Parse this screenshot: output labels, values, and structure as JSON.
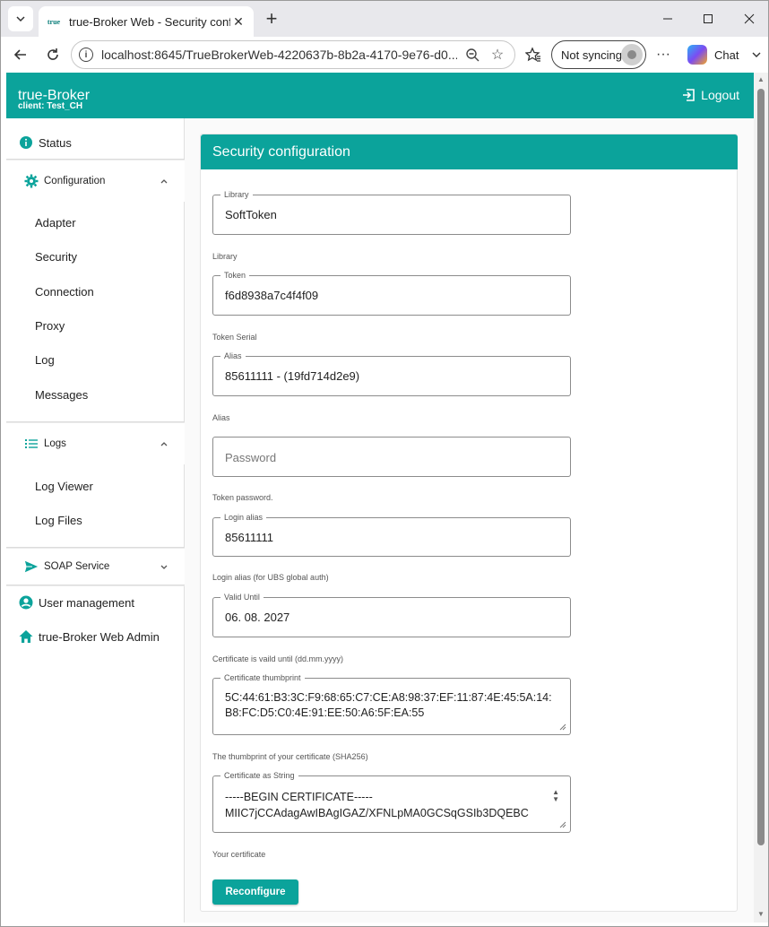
{
  "browser": {
    "tab_title": "true-Broker Web - Security configu",
    "favicon_text": "true",
    "url": "localhost:8645/TrueBrokerWeb-4220637b-8b2a-4170-9e76-d0...",
    "sync_label": "Not syncing",
    "chat_label": "Chat"
  },
  "appbar": {
    "title": "true-Broker",
    "subtitle": "client: Test_CH",
    "logout_label": "Logout"
  },
  "sidebar": {
    "status_label": "Status",
    "configuration_label": "Configuration",
    "configuration_items": [
      "Adapter",
      "Security",
      "Connection",
      "Proxy",
      "Log",
      "Messages"
    ],
    "logs_label": "Logs",
    "logs_items": [
      "Log Viewer",
      "Log Files"
    ],
    "soap_label": "SOAP Service",
    "user_management_label": "User management",
    "admin_label": "true-Broker Web Admin"
  },
  "form": {
    "title": "Security configuration",
    "library": {
      "legend": "Library",
      "value": "SoftToken",
      "hint": "Library"
    },
    "token": {
      "legend": "Token",
      "value": "f6d8938a7c4f4f09",
      "hint": "Token Serial"
    },
    "alias": {
      "legend": "Alias",
      "value": "85611111 - (19fd714d2e9)",
      "hint": "Alias"
    },
    "password": {
      "placeholder": "Password",
      "hint": "Token password."
    },
    "login_alias": {
      "legend": "Login alias",
      "value": "85611111",
      "hint": "Login alias (for UBS global auth)"
    },
    "valid_until": {
      "legend": "Valid Until",
      "value": "06. 08. 2027",
      "hint": "Certificate is vaild until (dd.mm.yyyy)"
    },
    "thumbprint": {
      "legend": "Certificate thumbprint",
      "value": "5C:44:61:B3:3C:F9:68:65:C7:CE:A8:98:37:EF:11:87:4E:45:5A:14:B8:FC:D5:C0:4E:91:EE:50:A6:5F:EA:55",
      "hint": "The thumbprint of your certificate (SHA256)"
    },
    "certificate": {
      "legend": "Certificate as String",
      "line1": "-----BEGIN CERTIFICATE-----",
      "line2": "MIIC7jCCAdagAwIBAgIGAZ/XFNLpMA0GCSqGSIb3DQEBC",
      "hint": "Your certificate"
    },
    "submit_label": "Reconfigure"
  },
  "colors": {
    "accent": "#0ba39b"
  }
}
